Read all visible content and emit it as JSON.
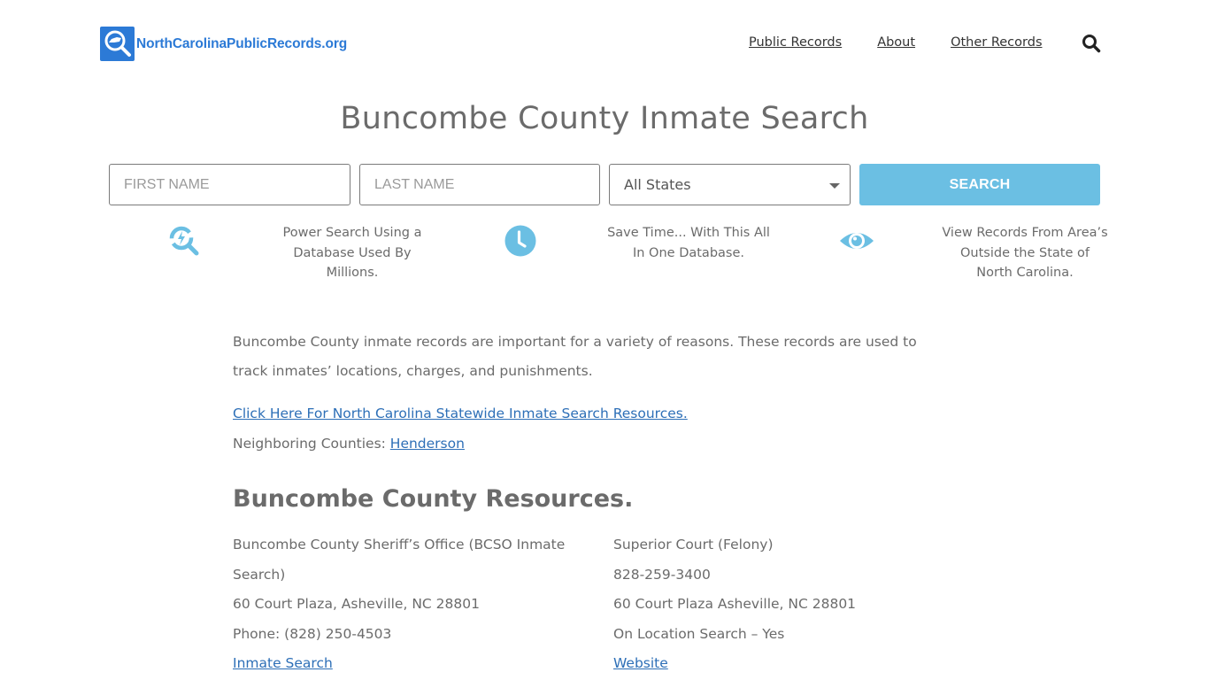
{
  "header": {
    "logo_text": "NorthCarolinaPublicRecords.org",
    "brand_color": "#2c7ad6",
    "nav": [
      {
        "label": "Public Records"
      },
      {
        "label": "About"
      },
      {
        "label": "Other Records"
      }
    ],
    "search_icon": "search-icon"
  },
  "page": {
    "title": "Buncombe County Inmate Search"
  },
  "search_form": {
    "first_name_placeholder": "FIRST NAME",
    "last_name_placeholder": "LAST NAME",
    "state_selected": "All States",
    "search_label": "SEARCH",
    "button_color": "#6bbfe3"
  },
  "features": [
    {
      "icon": "power-search-icon",
      "text": "Power Search Using a Database Used By Millions."
    },
    {
      "icon": "clock-icon",
      "text": "Save Time... With This All In One Database."
    },
    {
      "icon": "eye-icon",
      "text": "View Records From Area’s Outside the State of North Carolina."
    }
  ],
  "content": {
    "intro": "Buncombe County inmate records are important for a variety of reasons. These records are used to track inmates’ locations, charges, and punishments.",
    "statewide_link": "Click Here For North Carolina Statewide Inmate Search Resources.",
    "neighboring_label": "Neighboring Counties: ",
    "neighboring_link": "Henderson"
  },
  "resources": {
    "title": "Buncombe County Resources.",
    "left": {
      "name": "Buncombe County Sheriff’s Office (BCSO Inmate Search)",
      "address": "60 Court Plaza, Asheville, NC 28801",
      "phone": "Phone: (828) 250-4503",
      "link": "Inmate Search"
    },
    "right": {
      "name": "Superior Court (Felony)",
      "phone": "828-259-3400",
      "address": "60 Court Plaza Asheville, NC 28801",
      "on_location": "On Location Search – Yes",
      "link": "Website"
    }
  }
}
